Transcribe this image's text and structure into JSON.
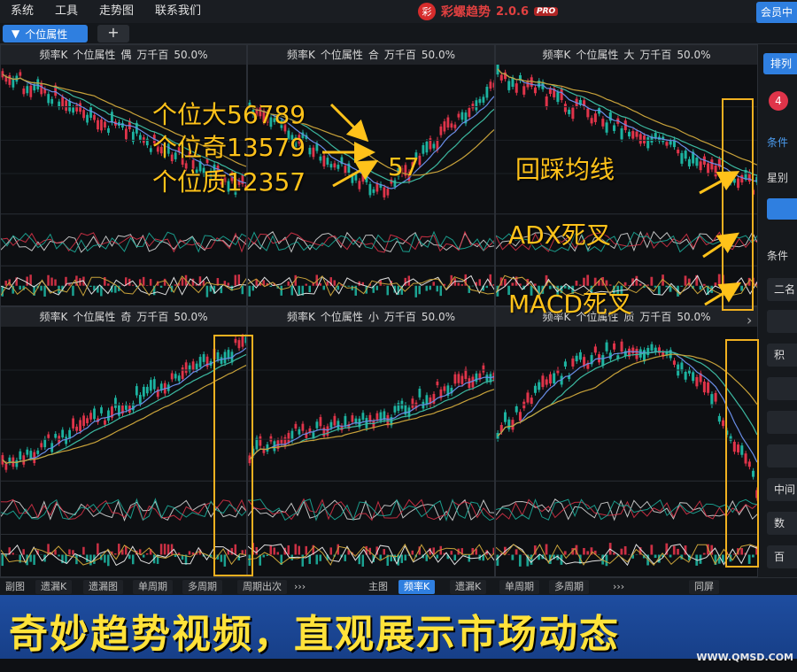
{
  "menu": [
    "系统",
    "工具",
    "走势图",
    "联系我们"
  ],
  "app": {
    "logo_char": "彩",
    "name": "彩螺趋势",
    "version": "2.0.6",
    "badge": "PRO"
  },
  "member_button": "会员中",
  "tabs": {
    "active": "个位属性",
    "add": "+"
  },
  "panels": [
    {
      "title": [
        "频率K",
        "个位属性",
        "偶",
        "万千百",
        "50.0%"
      ]
    },
    {
      "title": [
        "频率K",
        "个位属性",
        "合",
        "万千百",
        "50.0%"
      ]
    },
    {
      "title": [
        "频率K",
        "个位属性",
        "大",
        "万千百",
        "50.0%"
      ]
    },
    {
      "title": [
        "频率K",
        "个位属性",
        "奇",
        "万千百",
        "50.0%"
      ]
    },
    {
      "title": [
        "频率K",
        "个位属性",
        "小",
        "万千百",
        "50.0%"
      ]
    },
    {
      "title": [
        "频率K",
        "个位属性",
        "质",
        "万千百",
        "50.0%"
      ]
    }
  ],
  "sidebar": {
    "sort_button": "排列",
    "badge": "4",
    "conditions_label": "条件",
    "star_label": "星别",
    "cond_label": "条件",
    "boxes": [
      "二名",
      "积",
      "中间",
      "数",
      "百"
    ],
    "plus": "+"
  },
  "bottombar": {
    "items": [
      "副图",
      "遗漏K",
      "遗漏图",
      "单周期",
      "多周期",
      "周期出次",
      "›››",
      "主图",
      "频率K",
      "遗漏K",
      "单周期",
      "多周期",
      "›››",
      "同屏"
    ],
    "active": "频率K"
  },
  "annotations": {
    "line1": "个位大56789",
    "line2": "个位奇13579",
    "line3": "个位质12357",
    "num": "57",
    "pullback": "回踩均线",
    "adx": "ADX死叉",
    "macd": "MACD死叉"
  },
  "caption": "奇妙趋势视频，直观展示市场动态",
  "watermark": "WWW.QMSD.COM",
  "colors": {
    "accent": "#2f7fe0",
    "up": "#e0344a",
    "down": "#1db3a0",
    "annotation": "#ffc21a",
    "caption_bg": "#1e4da0",
    "caption_text": "#ffe23a"
  }
}
